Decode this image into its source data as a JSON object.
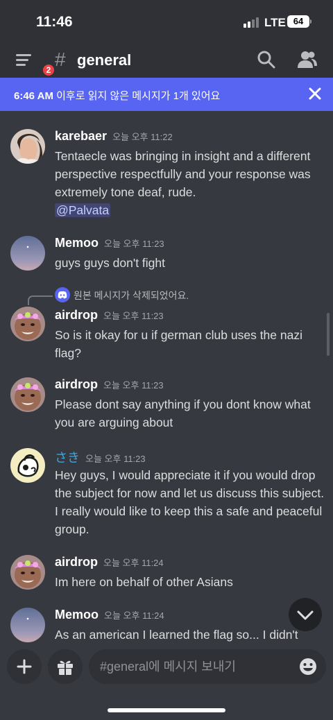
{
  "status_bar": {
    "time": "11:46",
    "network": "LTE",
    "battery": "64"
  },
  "header": {
    "channel_hash": "#",
    "channel_name": "general",
    "menu_badge": "2"
  },
  "unread_banner": {
    "time": "6:46 AM",
    "text": " 이후로 읽지 않은 메시지가 1개 있어요"
  },
  "messages": [
    {
      "author": "karebaer",
      "timestamp": "오늘 오후 11:22",
      "text": "Tentaecle was bringing in insight and a different perspective respectfully and your response was extremely tone deaf, rude.",
      "mention": "@Palvata"
    },
    {
      "author": "Memoo",
      "timestamp": "오늘 오후 11:23",
      "text": "guys guys don't fight"
    },
    {
      "reply_text": "원본 메시지가 삭제되었어요.",
      "author": "airdrop",
      "timestamp": "오늘 오후 11:23",
      "text": "So is it okay for u if german club uses the nazi flag?"
    },
    {
      "author": "airdrop",
      "timestamp": "오늘 오후 11:23",
      "text": "Please dont say anything if you dont know what you are arguing about"
    },
    {
      "author": "さき",
      "timestamp": "오늘 오후 11:23",
      "text": "Hey guys, I would appreciate it if you would drop the subject for now and let us discuss this subject. I really would like to keep this a safe and peaceful group."
    },
    {
      "author": "airdrop",
      "timestamp": "오늘 오후 11:24",
      "text": "Im here on behalf of other Asians"
    },
    {
      "author": "Memoo",
      "timestamp": "오늘 오후 11:24",
      "text": "As an american I learned the flag so... I didn't"
    }
  ],
  "composer": {
    "placeholder": "#general에 메시지 보내기"
  },
  "icons": {
    "menu": "hamburger-icon",
    "search": "search-icon",
    "members": "members-icon",
    "close": "close-icon",
    "add": "plus-icon",
    "gift": "gift-icon",
    "emoji": "emoji-icon",
    "jump": "chevron-down-icon",
    "discord": "discord-icon"
  },
  "colors": {
    "background": "#36393f",
    "header": "#2f3136",
    "blurple": "#5865f2",
    "badge": "#ed4245",
    "mention": "#414675"
  }
}
